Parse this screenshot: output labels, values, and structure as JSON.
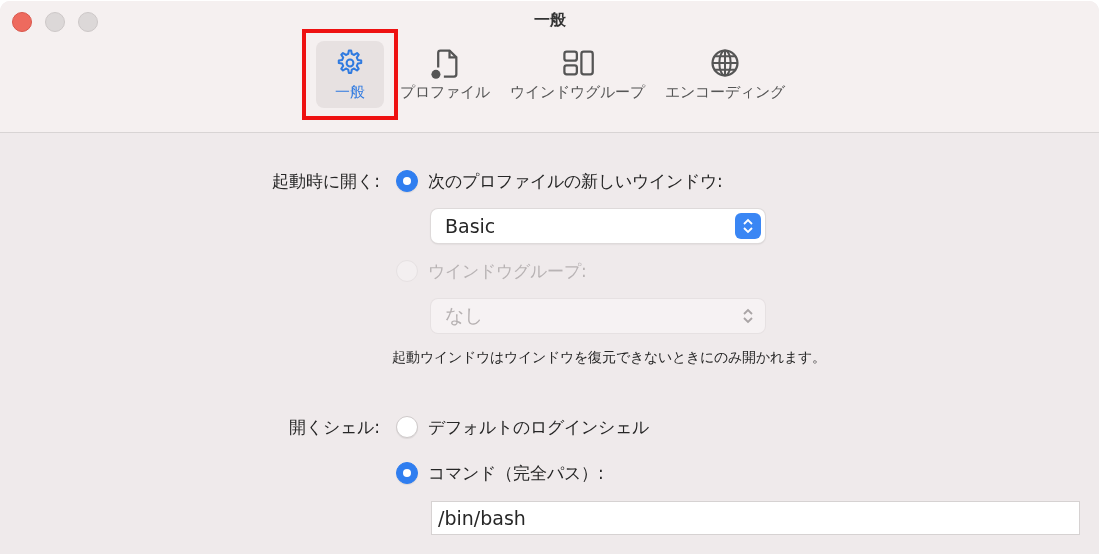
{
  "window": {
    "title": "一般"
  },
  "tabs": [
    {
      "label": "一般",
      "selected": true,
      "highlighted": true
    },
    {
      "label": "プロファイル",
      "selected": false,
      "highlighted": false
    },
    {
      "label": "ウインドウグループ",
      "selected": false,
      "highlighted": false
    },
    {
      "label": "エンコーディング",
      "selected": false,
      "highlighted": false
    }
  ],
  "startup": {
    "label": "起動時に開く:",
    "options": [
      {
        "label": "次のプロファイルの新しいウインドウ:",
        "selected": true,
        "disabled": false,
        "popup": {
          "value": "Basic",
          "disabled": false
        }
      },
      {
        "label": "ウインドウグループ:",
        "selected": false,
        "disabled": true,
        "popup": {
          "value": "なし",
          "disabled": true
        }
      }
    ],
    "note": "起動ウインドウはウインドウを復元できないときにのみ開かれます。"
  },
  "shell": {
    "label": "開くシェル:",
    "options": [
      {
        "label": "デフォルトのログインシェル",
        "selected": false,
        "disabled": false
      },
      {
        "label": "コマンド（完全パス）:",
        "selected": true,
        "disabled": false,
        "field": {
          "value": "/bin/bash"
        }
      }
    ]
  }
}
